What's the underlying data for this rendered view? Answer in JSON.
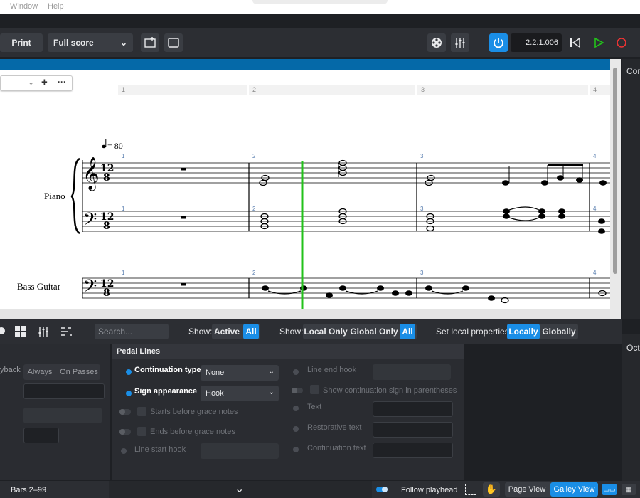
{
  "menu": {
    "items": [
      "Window",
      "Help"
    ]
  },
  "toolbar": {
    "print_label": "Print",
    "layout_value": "Full score",
    "transport_time": "2.2.1.006"
  },
  "score": {
    "ruler_numbers": [
      "1",
      "2",
      "3",
      "4"
    ],
    "tempo_text": "= 80",
    "time_signature_top": "12",
    "time_signature_bottom": "8",
    "staff_bar_numbers": [
      "1",
      "2",
      "3",
      "4"
    ],
    "instruments": [
      "Piano",
      "Bass Guitar"
    ]
  },
  "right_panel": {
    "top_label": "Cor",
    "lower_label": "Oct"
  },
  "lower_toolbar": {
    "search_placeholder": "Search...",
    "show_label_1": "Show:",
    "show_active": "Active",
    "show_all_1": "All",
    "show_label_2": "Show:",
    "local_only": "Local Only",
    "global_only": "Global Only",
    "show_all_2": "All",
    "set_local_label": "Set local properties:",
    "locally": "Locally",
    "globally": "Globally"
  },
  "left_props": {
    "playback_label": "yback",
    "always": "Always",
    "on_passes": "On Passes"
  },
  "pedal_lines": {
    "title": "Pedal Lines",
    "continuation_type_label": "Continuation type",
    "continuation_type_value": "None",
    "sign_appearance_label": "Sign appearance",
    "sign_appearance_value": "Hook",
    "starts_before_grace": "Starts before grace notes",
    "ends_before_grace": "Ends before grace notes",
    "line_start_hook": "Line start hook",
    "line_end_hook": "Line end hook",
    "show_continuation_paren": "Show continuation sign in parentheses",
    "text_label": "Text",
    "restorative_text": "Restorative text",
    "continuation_text": "Continuation text"
  },
  "status": {
    "bars": "Bars 2–99",
    "follow_playhead": "Follow playhead",
    "page_view": "Page View",
    "galley_view": "Galley View"
  },
  "colors": {
    "accent": "#1a8ee6",
    "playhead": "#22c21a",
    "strip": "#0569a8"
  }
}
